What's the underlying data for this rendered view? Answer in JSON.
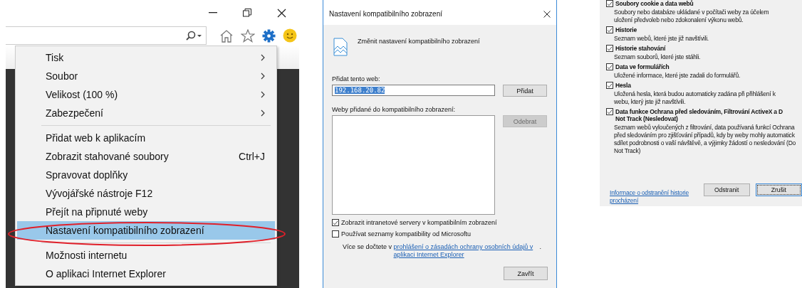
{
  "browser_menu": {
    "groups": [
      [
        {
          "label": "Tisk",
          "submenu": true,
          "selected": false
        },
        {
          "label": "Soubor",
          "submenu": true,
          "selected": false
        },
        {
          "label": "Velikost (100 %)",
          "submenu": true,
          "selected": false
        },
        {
          "label": "Zabezpečení",
          "submenu": true,
          "selected": false
        }
      ],
      [
        {
          "label": "Přidat web k aplikacím",
          "submenu": false,
          "selected": false
        },
        {
          "label": "Zobrazit stahované soubory",
          "shortcut": "Ctrl+J",
          "submenu": false,
          "selected": false
        },
        {
          "label": "Spravovat doplňky",
          "submenu": false,
          "selected": false
        },
        {
          "label": "Vývojářské nástroje F12",
          "submenu": false,
          "selected": false
        },
        {
          "label": "Přejít na připnuté weby",
          "submenu": false,
          "selected": false
        },
        {
          "label": "Nastavení kompatibilního zobrazení",
          "submenu": false,
          "selected": true
        }
      ],
      [
        {
          "label": "Možnosti internetu",
          "submenu": false,
          "selected": false
        },
        {
          "label": "O aplikaci Internet Explorer",
          "submenu": false,
          "selected": false
        }
      ]
    ]
  },
  "compat_dialog": {
    "title": "Nastavení kompatibilního zobrazení",
    "heading": "Změnit nastavení kompatibilního zobrazení",
    "add_label": "Přidat tento web:",
    "add_value": "192.168.20.82",
    "add_button": "Přidat",
    "list_label": "Weby přidané do kompatibilního zobrazení:",
    "remove_button": {
      "label": "Odebrat",
      "disabled": true
    },
    "checkboxes": [
      {
        "label": "Zobrazit intranetové servery v kompatibilním zobrazení",
        "checked": true
      },
      {
        "label": "Používat seznamy kompatibility od Microsoftu",
        "checked": false
      }
    ],
    "info": {
      "text": "Více se dočtete v ",
      "link": "prohlášení o zásadách ochrany osobních údajů v aplikaci Internet Explorer",
      "after": "."
    },
    "close_button": "Zavřít"
  },
  "delete_history": {
    "items": [
      {
        "title": "Soubory cookie a data webů",
        "checked": true,
        "description": [
          "Soubory nebo databáze ukládané v počítači weby za účelem",
          "uložení předvoleb nebo zdokonalení výkonu webů."
        ]
      },
      {
        "title": "Historie",
        "checked": true,
        "description": [
          "Seznam webů, které jste již navštívili."
        ]
      },
      {
        "title": "Historie stahování",
        "checked": true,
        "description": [
          "Seznam souborů, které jste stáhli."
        ]
      },
      {
        "title": "Data ve formulářích",
        "checked": true,
        "description": [
          "Uložené informace, které jste zadali do formulářů."
        ]
      },
      {
        "title": "Hesla",
        "checked": true,
        "description": [
          "Uložená hesla, která budou automaticky zadána při přihlášení k",
          "webu, který jste již navštívili."
        ]
      },
      {
        "title": "Data funkce Ochrana před sledováním, Filtrování ActiveX a D",
        "title_2": "Not Track (Nesledovat)",
        "checked": true,
        "description": [
          "Seznam webů vyloučených z filtrování, data používaná funkcí Ochrana",
          "před sledováním pro zjišťování případů, kdy by weby mohly automatick",
          "sdílet podrobnosti o vaší návštěvě, a výjimky žádostí o nesledování (Do",
          "Not Track)"
        ]
      }
    ],
    "link": "Informace o odstranění historie procházení",
    "buttons": [
      "Odstranit",
      "Zrušit"
    ]
  }
}
